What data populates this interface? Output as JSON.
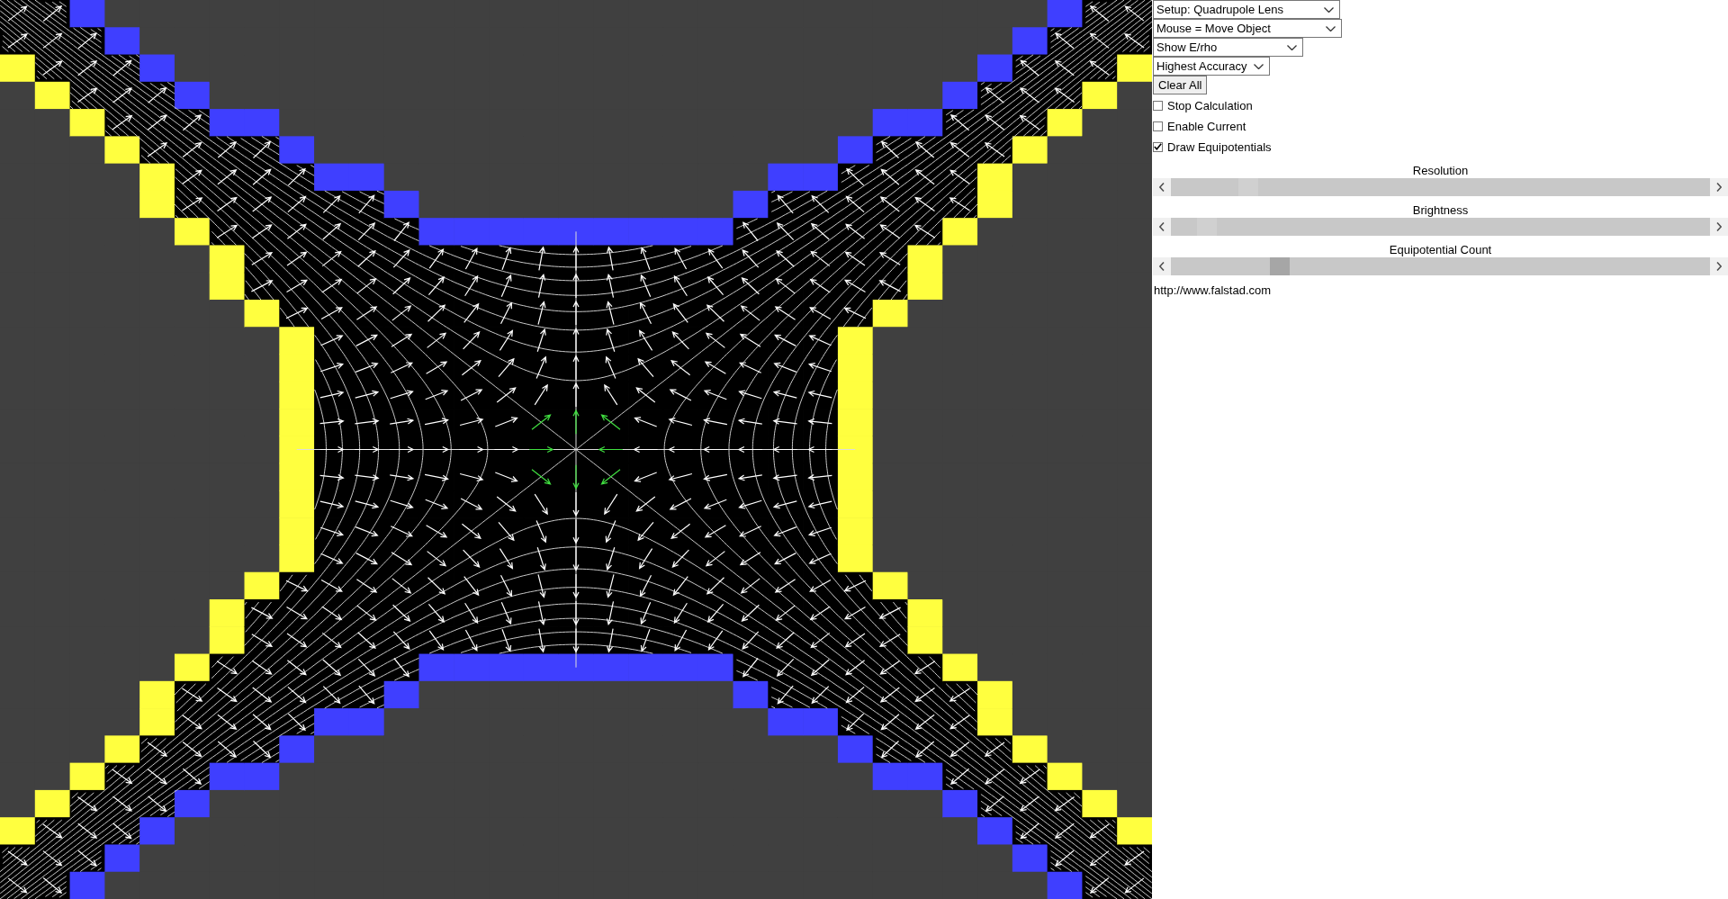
{
  "controls": {
    "dropdowns": [
      {
        "value": "Setup: Quadrupole Lens"
      },
      {
        "value": "Mouse = Move Object"
      },
      {
        "value": "Show E/rho"
      },
      {
        "value": "Highest Accuracy"
      }
    ],
    "button": "Clear All",
    "checkboxes": [
      {
        "label": "Stop Calculation",
        "checked": false
      },
      {
        "label": "Enable Current",
        "checked": false
      },
      {
        "label": "Draw Equipotentials",
        "checked": true
      }
    ],
    "sliders": [
      {
        "label": "Resolution",
        "level": 0.13,
        "active": false
      },
      {
        "label": "Brightness",
        "level": 0.05,
        "active": false
      },
      {
        "label": "Equipotential Count",
        "level": 0.19,
        "active": true
      }
    ],
    "link": "http://www.falstad.com"
  }
}
